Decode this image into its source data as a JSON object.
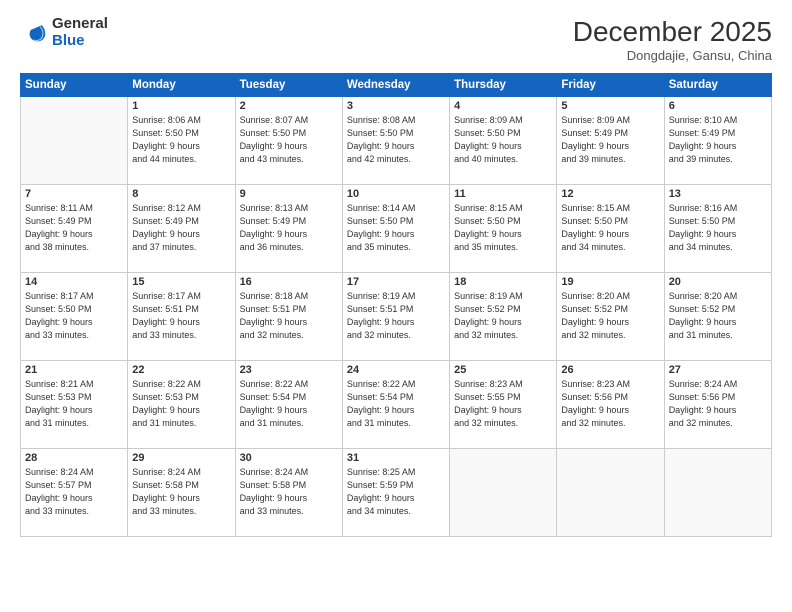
{
  "logo": {
    "general": "General",
    "blue": "Blue"
  },
  "header": {
    "month": "December 2025",
    "location": "Dongdajie, Gansu, China"
  },
  "weekdays": [
    "Sunday",
    "Monday",
    "Tuesday",
    "Wednesday",
    "Thursday",
    "Friday",
    "Saturday"
  ],
  "weeks": [
    [
      {
        "day": "",
        "text": ""
      },
      {
        "day": "1",
        "text": "Sunrise: 8:06 AM\nSunset: 5:50 PM\nDaylight: 9 hours\nand 44 minutes."
      },
      {
        "day": "2",
        "text": "Sunrise: 8:07 AM\nSunset: 5:50 PM\nDaylight: 9 hours\nand 43 minutes."
      },
      {
        "day": "3",
        "text": "Sunrise: 8:08 AM\nSunset: 5:50 PM\nDaylight: 9 hours\nand 42 minutes."
      },
      {
        "day": "4",
        "text": "Sunrise: 8:09 AM\nSunset: 5:50 PM\nDaylight: 9 hours\nand 40 minutes."
      },
      {
        "day": "5",
        "text": "Sunrise: 8:09 AM\nSunset: 5:49 PM\nDaylight: 9 hours\nand 39 minutes."
      },
      {
        "day": "6",
        "text": "Sunrise: 8:10 AM\nSunset: 5:49 PM\nDaylight: 9 hours\nand 39 minutes."
      }
    ],
    [
      {
        "day": "7",
        "text": "Sunrise: 8:11 AM\nSunset: 5:49 PM\nDaylight: 9 hours\nand 38 minutes."
      },
      {
        "day": "8",
        "text": "Sunrise: 8:12 AM\nSunset: 5:49 PM\nDaylight: 9 hours\nand 37 minutes."
      },
      {
        "day": "9",
        "text": "Sunrise: 8:13 AM\nSunset: 5:49 PM\nDaylight: 9 hours\nand 36 minutes."
      },
      {
        "day": "10",
        "text": "Sunrise: 8:14 AM\nSunset: 5:50 PM\nDaylight: 9 hours\nand 35 minutes."
      },
      {
        "day": "11",
        "text": "Sunrise: 8:15 AM\nSunset: 5:50 PM\nDaylight: 9 hours\nand 35 minutes."
      },
      {
        "day": "12",
        "text": "Sunrise: 8:15 AM\nSunset: 5:50 PM\nDaylight: 9 hours\nand 34 minutes."
      },
      {
        "day": "13",
        "text": "Sunrise: 8:16 AM\nSunset: 5:50 PM\nDaylight: 9 hours\nand 34 minutes."
      }
    ],
    [
      {
        "day": "14",
        "text": "Sunrise: 8:17 AM\nSunset: 5:50 PM\nDaylight: 9 hours\nand 33 minutes."
      },
      {
        "day": "15",
        "text": "Sunrise: 8:17 AM\nSunset: 5:51 PM\nDaylight: 9 hours\nand 33 minutes."
      },
      {
        "day": "16",
        "text": "Sunrise: 8:18 AM\nSunset: 5:51 PM\nDaylight: 9 hours\nand 32 minutes."
      },
      {
        "day": "17",
        "text": "Sunrise: 8:19 AM\nSunset: 5:51 PM\nDaylight: 9 hours\nand 32 minutes."
      },
      {
        "day": "18",
        "text": "Sunrise: 8:19 AM\nSunset: 5:52 PM\nDaylight: 9 hours\nand 32 minutes."
      },
      {
        "day": "19",
        "text": "Sunrise: 8:20 AM\nSunset: 5:52 PM\nDaylight: 9 hours\nand 32 minutes."
      },
      {
        "day": "20",
        "text": "Sunrise: 8:20 AM\nSunset: 5:52 PM\nDaylight: 9 hours\nand 31 minutes."
      }
    ],
    [
      {
        "day": "21",
        "text": "Sunrise: 8:21 AM\nSunset: 5:53 PM\nDaylight: 9 hours\nand 31 minutes."
      },
      {
        "day": "22",
        "text": "Sunrise: 8:22 AM\nSunset: 5:53 PM\nDaylight: 9 hours\nand 31 minutes."
      },
      {
        "day": "23",
        "text": "Sunrise: 8:22 AM\nSunset: 5:54 PM\nDaylight: 9 hours\nand 31 minutes."
      },
      {
        "day": "24",
        "text": "Sunrise: 8:22 AM\nSunset: 5:54 PM\nDaylight: 9 hours\nand 31 minutes."
      },
      {
        "day": "25",
        "text": "Sunrise: 8:23 AM\nSunset: 5:55 PM\nDaylight: 9 hours\nand 32 minutes."
      },
      {
        "day": "26",
        "text": "Sunrise: 8:23 AM\nSunset: 5:56 PM\nDaylight: 9 hours\nand 32 minutes."
      },
      {
        "day": "27",
        "text": "Sunrise: 8:24 AM\nSunset: 5:56 PM\nDaylight: 9 hours\nand 32 minutes."
      }
    ],
    [
      {
        "day": "28",
        "text": "Sunrise: 8:24 AM\nSunset: 5:57 PM\nDaylight: 9 hours\nand 33 minutes."
      },
      {
        "day": "29",
        "text": "Sunrise: 8:24 AM\nSunset: 5:58 PM\nDaylight: 9 hours\nand 33 minutes."
      },
      {
        "day": "30",
        "text": "Sunrise: 8:24 AM\nSunset: 5:58 PM\nDaylight: 9 hours\nand 33 minutes."
      },
      {
        "day": "31",
        "text": "Sunrise: 8:25 AM\nSunset: 5:59 PM\nDaylight: 9 hours\nand 34 minutes."
      },
      {
        "day": "",
        "text": ""
      },
      {
        "day": "",
        "text": ""
      },
      {
        "day": "",
        "text": ""
      }
    ]
  ]
}
